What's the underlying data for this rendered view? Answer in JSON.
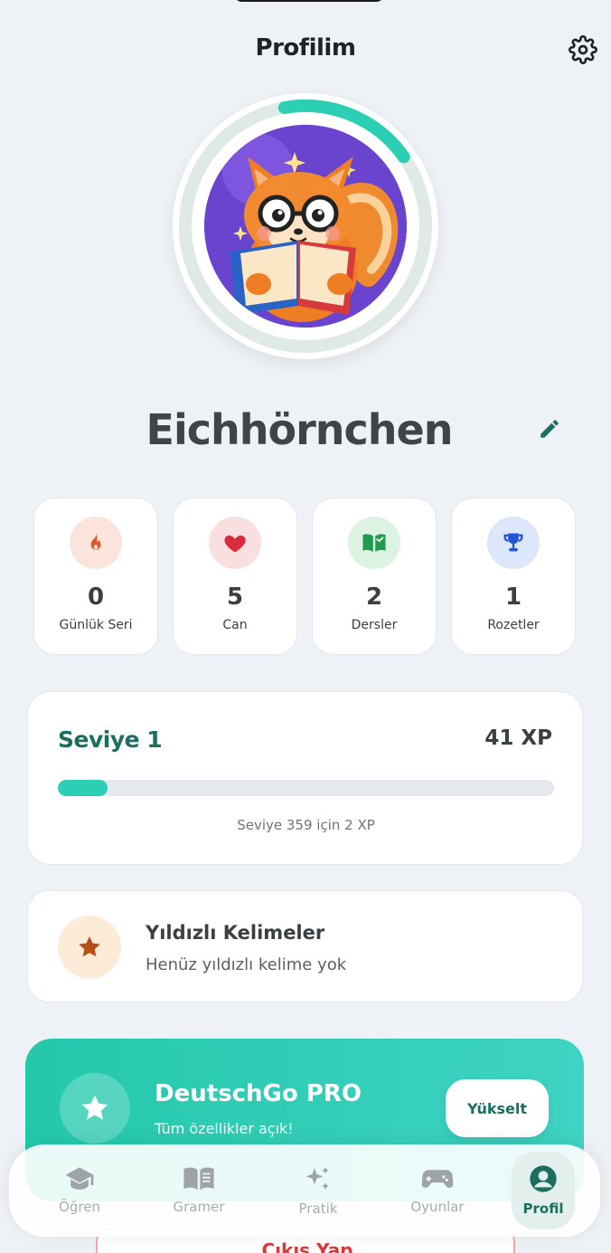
{
  "header": {
    "title": "Profilim",
    "settings_icon": "gear-icon"
  },
  "profile": {
    "username": "Eichhörnchen",
    "edit_icon": "pencil-icon",
    "avatar_alt": "squirrel-reading-avatar",
    "level_progress": 0.18
  },
  "stats": [
    {
      "value": "0",
      "label": "Günlük Seri",
      "icon": "flame-icon",
      "color": "#e2572c",
      "bg": "#fbe4dc"
    },
    {
      "value": "5",
      "label": "Can",
      "icon": "heart-icon",
      "color": "#d92b3a",
      "bg": "#fadfe1"
    },
    {
      "value": "2",
      "label": "Dersler",
      "icon": "open-book-icon",
      "color": "#1f9a4f",
      "bg": "#dbf3e3"
    },
    {
      "value": "1",
      "label": "Rozetler",
      "icon": "trophy-icon",
      "color": "#2255d6",
      "bg": "#dde7fb"
    }
  ],
  "level": {
    "title": "Seviye 1",
    "xp": "41 XP",
    "progress": 0.1,
    "subtitle": "Seviye 359 için 2 XP",
    "accent": "#2ccfb4"
  },
  "starred": {
    "title": "Yıldızlı Kelimeler",
    "subtitle": "Henüz yıldızlı kelime yok",
    "icon": "star-icon"
  },
  "pro": {
    "title": "DeutschGo PRO",
    "subtitle": "Tüm özellikler açık!",
    "button": "Yükselt",
    "icon": "star-icon"
  },
  "logout": {
    "label": "Çıkış Yap"
  },
  "tabbar": {
    "items": [
      {
        "label": "Öğren",
        "icon": "graduation-cap-icon",
        "active": false
      },
      {
        "label": "Gramer",
        "icon": "book-icon",
        "active": false
      },
      {
        "label": "Pratik",
        "icon": "sparkles-icon",
        "active": false
      },
      {
        "label": "Oyunlar",
        "icon": "gamepad-icon",
        "active": false
      },
      {
        "label": "Profil",
        "icon": "user-circle-icon",
        "active": true
      }
    ]
  }
}
